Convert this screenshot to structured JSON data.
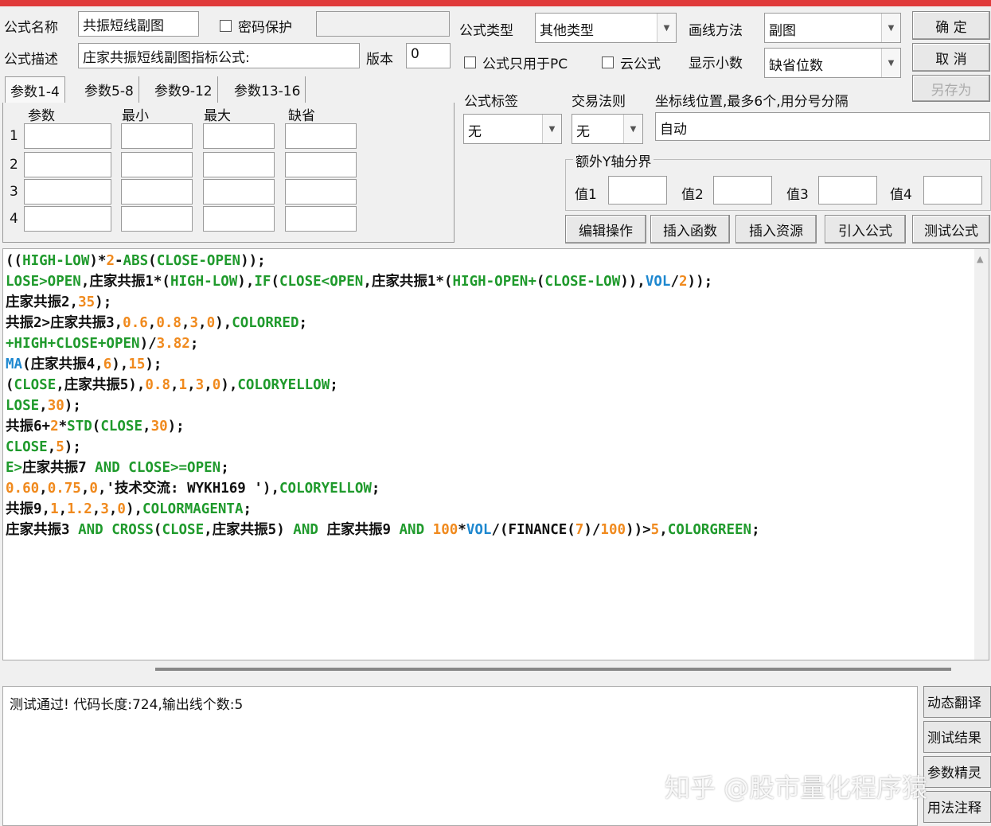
{
  "header": {
    "name_label": "公式名称",
    "name_value": "共振短线副图",
    "password_label": "密码保护",
    "desc_label": "公式描述",
    "desc_value": "庄家共振短线副图指标公式:",
    "version_label": "版本",
    "version_value": "0",
    "type_label": "公式类型",
    "type_value": "其他类型",
    "draw_label": "画线方法",
    "draw_value": "副图",
    "pc_only_label": "公式只用于PC",
    "cloud_label": "云公式",
    "decimal_label": "显示小数",
    "decimal_value": "缺省位数"
  },
  "buttons": {
    "ok": "确 定",
    "cancel": "取 消",
    "save_as": "另存为"
  },
  "tabs": [
    "参数1-4",
    "参数5-8",
    "参数9-12",
    "参数13-16"
  ],
  "params": {
    "headers": [
      "参数",
      "最小",
      "最大",
      "缺省"
    ],
    "rows": [
      "1",
      "2",
      "3",
      "4"
    ]
  },
  "right": {
    "tag_label": "公式标签",
    "tag_value": "无",
    "rule_label": "交易法则",
    "rule_value": "无",
    "axis_label": "坐标线位置,最多6个,用分号分隔",
    "axis_value": "自动",
    "extra_y_label": "额外Y轴分界",
    "values": [
      "值1",
      "值2",
      "值3",
      "值4"
    ]
  },
  "actions": [
    "编辑操作",
    "插入函数",
    "插入资源",
    "引入公式",
    "测试公式"
  ],
  "code_lines": [
    [
      [
        "k",
        "(("
      ],
      [
        "g",
        "HIGH-LOW"
      ],
      [
        "k",
        ")*"
      ],
      [
        "o",
        "2"
      ],
      [
        "k",
        "-"
      ],
      [
        "g",
        "ABS"
      ],
      [
        "k",
        "("
      ],
      [
        "g",
        "CLOSE-OPEN"
      ],
      [
        "k",
        "));"
      ]
    ],
    [
      [
        "g",
        "LOSE>OPEN"
      ],
      [
        "k",
        ",庄家共振1*("
      ],
      [
        "g",
        "HIGH-LOW"
      ],
      [
        "k",
        "),"
      ],
      [
        "g",
        "IF"
      ],
      [
        "k",
        "("
      ],
      [
        "g",
        "CLOSE<OPEN"
      ],
      [
        "k",
        ",庄家共振1*("
      ],
      [
        "g",
        "HIGH-OPEN+"
      ],
      [
        "k",
        "("
      ],
      [
        "g",
        "CLOSE-LOW"
      ],
      [
        "k",
        ")),"
      ],
      [
        "b",
        "VOL"
      ],
      [
        "k",
        "/"
      ],
      [
        "o",
        "2"
      ],
      [
        "k",
        "));"
      ]
    ],
    [
      [
        "k",
        "庄家共振2,"
      ],
      [
        "o",
        "35"
      ],
      [
        "k",
        ");"
      ]
    ],
    [
      [
        "k",
        "共振2>庄家共振3,"
      ],
      [
        "o",
        "0.6"
      ],
      [
        "k",
        ","
      ],
      [
        "o",
        "0.8"
      ],
      [
        "k",
        ","
      ],
      [
        "o",
        "3"
      ],
      [
        "k",
        ","
      ],
      [
        "o",
        "0"
      ],
      [
        "k",
        "),"
      ],
      [
        "g",
        "COLORRED"
      ],
      [
        "k",
        ";"
      ]
    ],
    [
      [
        "g",
        "+HIGH+CLOSE+OPEN"
      ],
      [
        "k",
        ")/"
      ],
      [
        "o",
        "3.82"
      ],
      [
        "k",
        ";"
      ]
    ],
    [
      [
        "b",
        "MA"
      ],
      [
        "k",
        "(庄家共振4,"
      ],
      [
        "o",
        "6"
      ],
      [
        "k",
        "),"
      ],
      [
        "o",
        "15"
      ],
      [
        "k",
        ");"
      ]
    ],
    [
      [
        "k",
        "("
      ],
      [
        "g",
        "CLOSE"
      ],
      [
        "k",
        ",庄家共振5),"
      ],
      [
        "o",
        "0.8"
      ],
      [
        "k",
        ","
      ],
      [
        "o",
        "1"
      ],
      [
        "k",
        ","
      ],
      [
        "o",
        "3"
      ],
      [
        "k",
        ","
      ],
      [
        "o",
        "0"
      ],
      [
        "k",
        "),"
      ],
      [
        "g",
        "COLORYELLOW"
      ],
      [
        "k",
        ";"
      ]
    ],
    [
      [
        "g",
        "LOSE"
      ],
      [
        "k",
        ","
      ],
      [
        "o",
        "30"
      ],
      [
        "k",
        ");"
      ]
    ],
    [
      [
        "k",
        "共振6+"
      ],
      [
        "o",
        "2"
      ],
      [
        "k",
        "*"
      ],
      [
        "g",
        "STD"
      ],
      [
        "k",
        "("
      ],
      [
        "g",
        "CLOSE"
      ],
      [
        "k",
        ","
      ],
      [
        "o",
        "30"
      ],
      [
        "k",
        ");"
      ]
    ],
    [
      [
        "g",
        "CLOSE"
      ],
      [
        "k",
        ","
      ],
      [
        "o",
        "5"
      ],
      [
        "k",
        ");"
      ]
    ],
    [
      [
        "g",
        "E>"
      ],
      [
        "k",
        "庄家共振7 "
      ],
      [
        "g",
        "AND CLOSE>=OPEN"
      ],
      [
        "k",
        ";"
      ]
    ],
    [
      [
        "o",
        "0.60"
      ],
      [
        "k",
        ","
      ],
      [
        "o",
        "0.75"
      ],
      [
        "k",
        ","
      ],
      [
        "o",
        "0"
      ],
      [
        "k",
        ",'技术交流: WYKH169 '),"
      ],
      [
        "g",
        "COLORYELLOW"
      ],
      [
        "k",
        ";"
      ]
    ],
    [
      [
        "k",
        "共振9,"
      ],
      [
        "o",
        "1"
      ],
      [
        "k",
        ","
      ],
      [
        "o",
        "1.2"
      ],
      [
        "k",
        ","
      ],
      [
        "o",
        "3"
      ],
      [
        "k",
        ","
      ],
      [
        "o",
        "0"
      ],
      [
        "k",
        "),"
      ],
      [
        "g",
        "COLORMAGENTA"
      ],
      [
        "k",
        ";"
      ]
    ],
    [
      [
        "k",
        "庄家共振3 "
      ],
      [
        "g",
        "AND CROSS"
      ],
      [
        "k",
        "("
      ],
      [
        "g",
        "CLOSE"
      ],
      [
        "k",
        ",庄家共振5) "
      ],
      [
        "g",
        "AND"
      ],
      [
        "k",
        " 庄家共振9 "
      ],
      [
        "g",
        "AND"
      ],
      [
        "k",
        " "
      ],
      [
        "o",
        "100"
      ],
      [
        "k",
        "*"
      ],
      [
        "b",
        "VOL"
      ],
      [
        "k",
        "/(FINANCE("
      ],
      [
        "o",
        "7"
      ],
      [
        "k",
        ")/"
      ],
      [
        "o",
        "100"
      ],
      [
        "k",
        "))>"
      ],
      [
        "o",
        "5"
      ],
      [
        "k",
        ","
      ],
      [
        "g",
        "COLORGREEN"
      ],
      [
        "k",
        ";"
      ]
    ]
  ],
  "status": "测试通过! 代码长度:724,输出线个数:5",
  "side_buttons": [
    "动态翻译",
    "测试结果",
    "参数精灵",
    "用法注释"
  ],
  "watermark": "知乎 @股市量化程序猿"
}
